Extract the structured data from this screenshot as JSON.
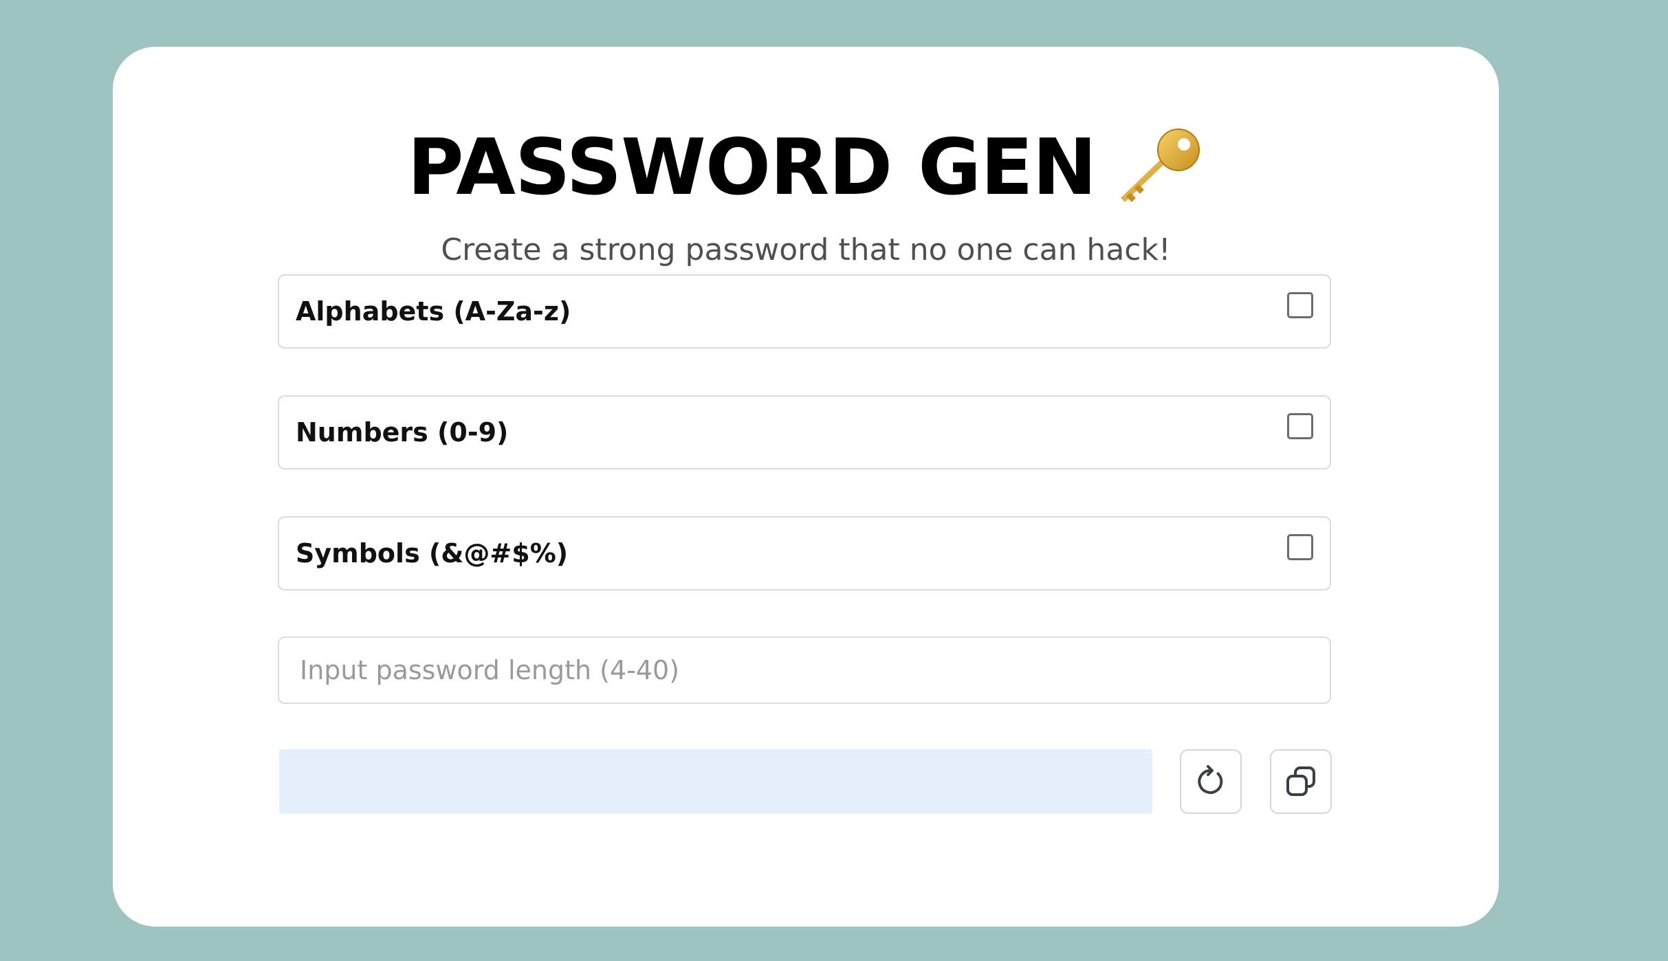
{
  "app": {
    "title": "PASSWORD GEN",
    "title_icon": "key-icon",
    "subtitle": "Create a strong password that no one can hack!"
  },
  "options": [
    {
      "label": "Alphabets (A-Za-z)",
      "checked": false
    },
    {
      "label": "Numbers (0-9)",
      "checked": false
    },
    {
      "label": "Symbols (&@#$%)",
      "checked": false
    }
  ],
  "length_input": {
    "placeholder": "Input password length (4-40)",
    "value": ""
  },
  "output": {
    "password": ""
  },
  "buttons": {
    "refresh_icon": "refresh-icon",
    "copy_icon": "copy-icon"
  },
  "colors": {
    "background": "#9dc4c1",
    "card": "#ffffff",
    "output_fill": "#e5effb",
    "key_gold": "#e8b53a"
  }
}
